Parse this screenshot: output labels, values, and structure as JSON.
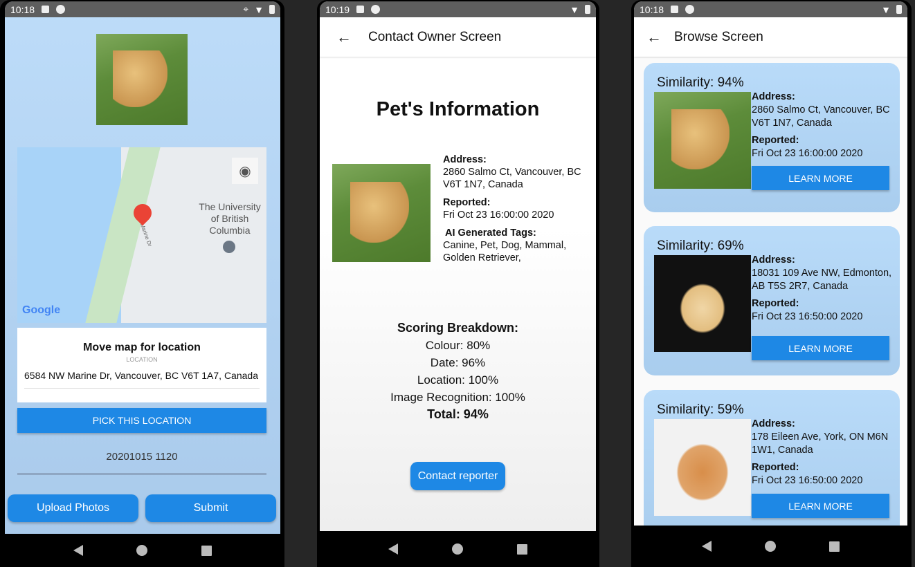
{
  "phones": [
    {
      "time": "10:18"
    },
    {
      "time": "10:19"
    },
    {
      "time": "10:18"
    }
  ],
  "report": {
    "map_labels": {
      "university": "The University of British Columbia",
      "road": "NW Marine Dr",
      "logo": "Google"
    },
    "location_title": "Move map for location",
    "location_label": "LOCATION",
    "location_value": "6584 NW Marine Dr, Vancouver, BC V6T 1A7, Canada",
    "pick_button": "PICK THIS LOCATION",
    "datetime": "20201015 1120",
    "upload_button": "Upload Photos",
    "submit_button": "Submit"
  },
  "contact": {
    "title": "Contact Owner Screen",
    "heading": "Pet's Information",
    "address_label": "Address:",
    "address": "2860 Salmo Ct, Vancouver, BC V6T 1N7, Canada",
    "reported_label": "Reported:",
    "reported": "Fri Oct 23 16:00:00 2020",
    "tags_label": "AI Generated Tags:",
    "tags": "Canine, Pet, Dog, Mammal, Golden Retriever,",
    "scoring_title": "Scoring Breakdown:",
    "scores": [
      "Colour: 80%",
      "Date: 96%",
      "Location: 100%",
      "Image Recognition: 100%"
    ],
    "total": "Total: 94%",
    "contact_button": "Contact reporter"
  },
  "browse": {
    "title": "Browse Screen",
    "address_label": "Address:",
    "reported_label": "Reported:",
    "learn_more": "LEARN MORE",
    "results": [
      {
        "similarity": "Similarity: 94%",
        "address": "2860 Salmo Ct, Vancouver, BC V6T 1N7, Canada",
        "reported": "Fri Oct 23 16:00:00 2020",
        "image": "golden-retriever"
      },
      {
        "similarity": "Similarity: 69%",
        "address": "18031 109 Ave NW, Edmonton, AB T5S 2R7, Canada",
        "reported": "Fri Oct 23 16:50:00 2020",
        "image": "puppy"
      },
      {
        "similarity": "Similarity: 59%",
        "address": "178 Eileen Ave, York, ON M6N 1W1, Canada",
        "reported": "Fri Oct 23 16:50:00 2020",
        "image": "hamster"
      }
    ]
  },
  "colors": {
    "accent": "#1e88e5",
    "card": "#b9dbf9",
    "status_bar": "#5e5e5e"
  }
}
